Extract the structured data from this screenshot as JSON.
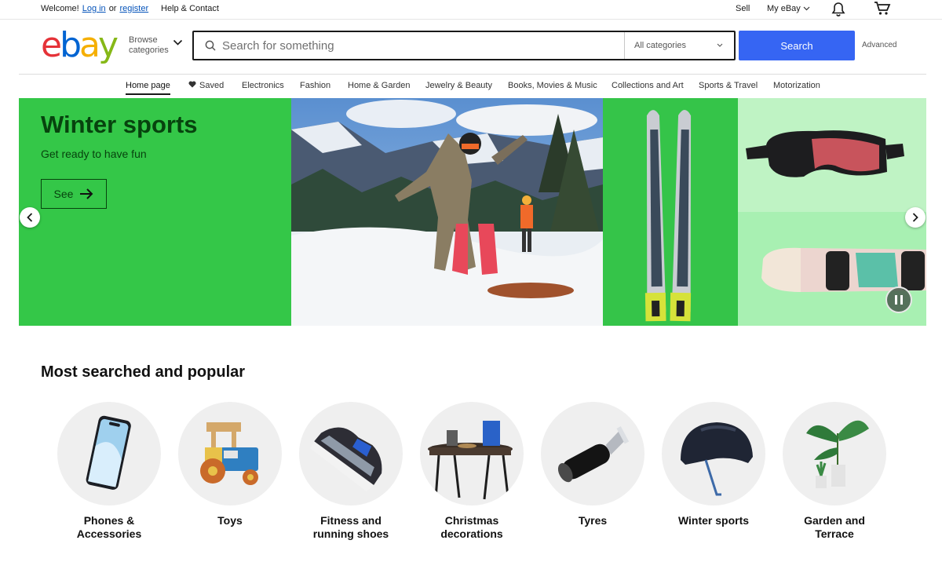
{
  "topbar": {
    "welcome": "Welcome!",
    "login": "Log in",
    "or": "or",
    "register": "register",
    "help": "Help & Contact",
    "sell": "Sell",
    "my_ebay": "My eBay"
  },
  "header": {
    "logo": {
      "e": "e",
      "b": "b",
      "a": "a",
      "y": "y"
    },
    "browse_line1": "Browse",
    "browse_line2": "categories",
    "search_placeholder": "Search for something",
    "category_selected": "All categories",
    "search_button": "Search",
    "advanced": "Advanced"
  },
  "nav": {
    "items": [
      "Home page",
      "Saved",
      "Electronics",
      "Fashion",
      "Home & Garden",
      "Jewelry & Beauty",
      "Books, Movies & Music",
      "Collections and Art",
      "Sports & Travel",
      "Motorization"
    ]
  },
  "hero": {
    "title": "Winter sports",
    "subtitle": "Get ready to have fun",
    "button": "See",
    "colors": {
      "panel": "#34c748",
      "text": "#07430e"
    }
  },
  "popular": {
    "title": "Most searched and popular",
    "categories": [
      {
        "line1": "Phones &",
        "line2": "Accessories",
        "icon": "phone-icon"
      },
      {
        "line1": "Toys",
        "line2": "",
        "icon": "toy-tractor-icon"
      },
      {
        "line1": "Fitness and",
        "line2": "running shoes",
        "icon": "shoe-icon"
      },
      {
        "line1": "Christmas",
        "line2": "decorations",
        "icon": "table-decor-icon"
      },
      {
        "line1": "Tyres",
        "line2": "",
        "icon": "exhaust-pipe-icon"
      },
      {
        "line1": "Winter sports",
        "line2": "",
        "icon": "helmet-icon"
      },
      {
        "line1": "Garden and",
        "line2": "Terrace",
        "icon": "plant-icon"
      }
    ]
  },
  "colors": {
    "accent": "#3665f3",
    "link": "#0654ba"
  }
}
